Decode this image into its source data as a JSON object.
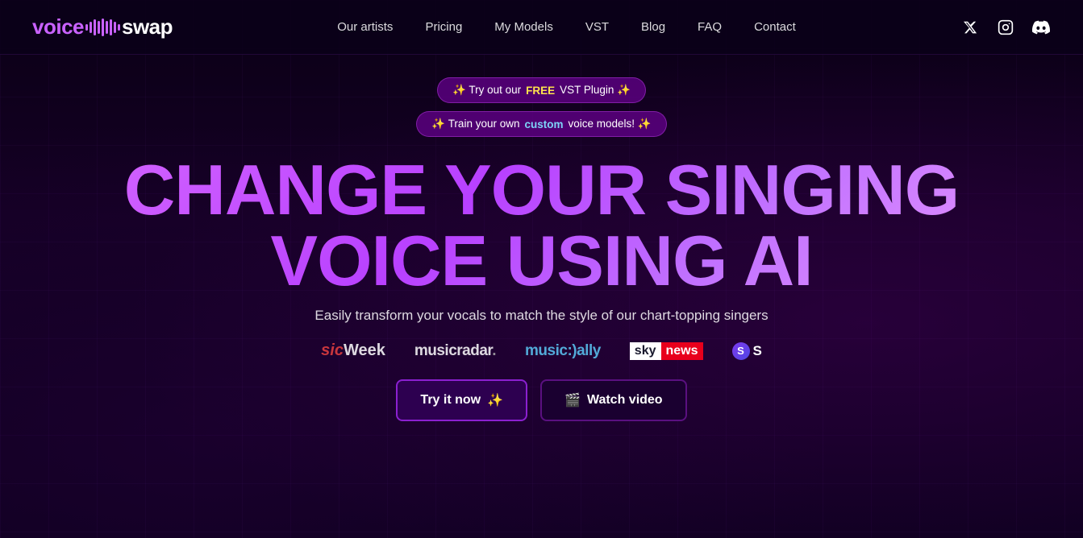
{
  "nav": {
    "logo": {
      "voice": "voice",
      "swap": "swap"
    },
    "links": [
      {
        "id": "our-artists",
        "label": "Our artists",
        "href": "#"
      },
      {
        "id": "pricing",
        "label": "Pricing",
        "href": "#"
      },
      {
        "id": "my-models",
        "label": "My Models",
        "href": "#"
      },
      {
        "id": "vst",
        "label": "VST",
        "href": "#"
      },
      {
        "id": "blog",
        "label": "Blog",
        "href": "#"
      },
      {
        "id": "faq",
        "label": "FAQ",
        "href": "#"
      },
      {
        "id": "contact",
        "label": "Contact",
        "href": "#"
      }
    ]
  },
  "banners": {
    "banner1": {
      "prefix": "✨ Try out our ",
      "highlight": "FREE",
      "suffix": " VST Plugin ✨"
    },
    "banner2": {
      "prefix": "✨ Train your own ",
      "highlight": "custom",
      "suffix": " voice models! ✨"
    }
  },
  "hero": {
    "title_line1": "CHANGE YOUR SINGING",
    "title_line2": "VOICE USING AI",
    "subtitle": "Easily transform your vocals to match the style of our chart-topping singers"
  },
  "press_logos": [
    {
      "id": "musicweek",
      "text": "MusicWeek",
      "prefix": "sic"
    },
    {
      "id": "musicradar",
      "text": "musicradar."
    },
    {
      "id": "musicallly",
      "text": "music:)ally"
    },
    {
      "id": "skynews",
      "sky": "sky",
      "news": "news"
    },
    {
      "id": "scratchpad",
      "letter": "S"
    }
  ],
  "cta": {
    "primary_label": "Try it now",
    "primary_sparkle": "✨",
    "secondary_label": "Watch video",
    "secondary_icon": "🎬"
  }
}
